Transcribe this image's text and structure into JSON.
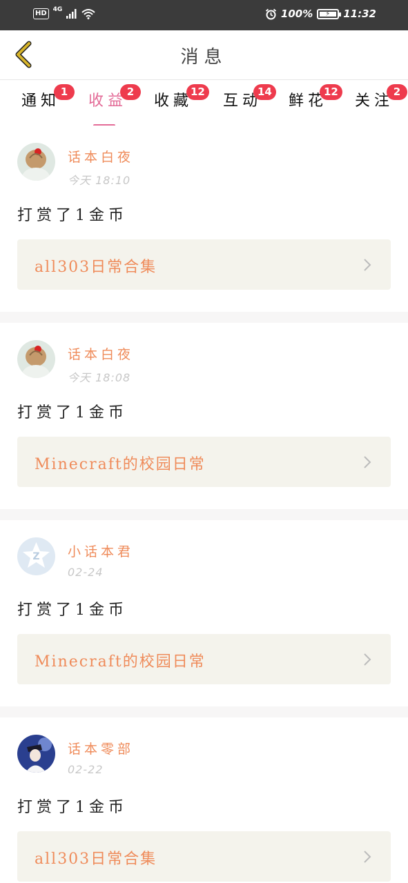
{
  "status_bar": {
    "hd": "HD",
    "network": "4G",
    "battery": "100%",
    "time": "11:32"
  },
  "header": {
    "back_icon": "chevron-left-icon",
    "title": "消息"
  },
  "tabs": [
    {
      "label": "通知",
      "badge": "1",
      "active": false
    },
    {
      "label": "收益",
      "badge": "2",
      "active": true
    },
    {
      "label": "收藏",
      "badge": "12",
      "active": false
    },
    {
      "label": "互动",
      "badge": "14",
      "active": false
    },
    {
      "label": "鲜花",
      "badge": "12",
      "active": false
    },
    {
      "label": "关注",
      "badge": "2",
      "active": false
    }
  ],
  "messages": [
    {
      "username": "话本白夜",
      "time": "今天 18:10",
      "action": "打赏了1金币",
      "work": "all303日常合集",
      "avatar": "doll-avatar"
    },
    {
      "username": "话本白夜",
      "time": "今天 18:08",
      "action": "打赏了1金币",
      "work": "Minecraft的校园日常",
      "avatar": "doll-avatar"
    },
    {
      "username": "小话本君",
      "time": "02-24",
      "action": "打赏了1金币",
      "work": "Minecraft的校园日常",
      "avatar": "default-z-avatar"
    },
    {
      "username": "话本零部",
      "time": "02-22",
      "action": "打赏了1金币",
      "work": "all303日常合集",
      "avatar": "anime-avatar"
    }
  ],
  "colors": {
    "accent": "#e36b97",
    "username": "#ef8b5a",
    "badge": "#ee3b4d",
    "work_box": "#f4f3ec",
    "back_arrow": "#c9a227"
  }
}
